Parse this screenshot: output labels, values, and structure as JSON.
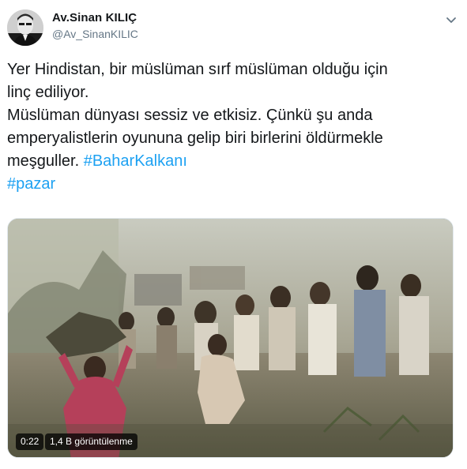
{
  "tweet": {
    "author": {
      "display_name": "Av.Sinan KILIÇ",
      "handle": "@Av_SinanKILIC"
    },
    "menu_icon": "chevron-down-icon",
    "text_lines": [
      "Yer Hindistan, bir müslüman sırf müslüman olduğu için",
      "linç ediliyor.",
      "Müslüman dünyası sessiz ve etkisiz. Çünkü şu anda",
      "emperyalistlerin oyununa gelip biri birlerini öldürmekle",
      "meşguller."
    ],
    "hashtags": [
      "#BaharKalkanı",
      "#pazar"
    ],
    "video": {
      "duration": "0:22",
      "views": "1,4 B görüntülenme"
    }
  },
  "colors": {
    "link": "#1da1f2",
    "secondary_text": "#657786",
    "primary_text": "#14171a"
  }
}
